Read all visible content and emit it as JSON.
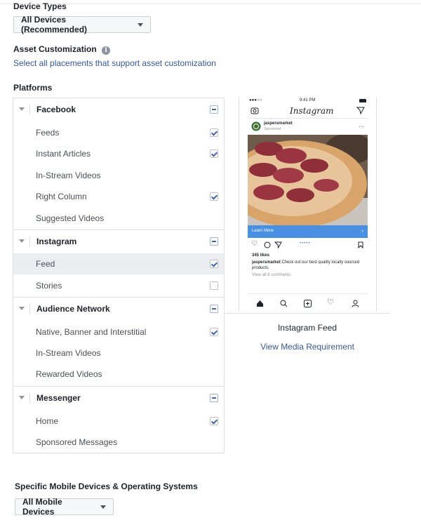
{
  "device_types": {
    "label": "Device Types",
    "dropdown": "All Devices (Recommended)"
  },
  "asset_customization": {
    "label": "Asset Customization",
    "info_icon": "info-icon",
    "link": "Select all placements that support asset customization"
  },
  "platforms": {
    "label": "Platforms",
    "groups": [
      {
        "title": "Facebook",
        "items": [
          {
            "label": "Feeds",
            "checked": true
          },
          {
            "label": "Instant Articles",
            "checked": true
          },
          {
            "label": "In-Stream Videos",
            "checked": false
          },
          {
            "label": "Right Column",
            "checked": true
          },
          {
            "label": "Suggested Videos",
            "checked": false
          }
        ]
      },
      {
        "title": "Instagram",
        "items": [
          {
            "label": "Feed",
            "checked": true
          },
          {
            "label": "Stories",
            "checked": false
          }
        ]
      },
      {
        "title": "Audience Network",
        "items": [
          {
            "label": "Native, Banner and Interstitial",
            "checked": true
          },
          {
            "label": "In-Stream Videos",
            "checked": false
          },
          {
            "label": "Rewarded Videos",
            "checked": false
          }
        ]
      },
      {
        "title": "Messenger",
        "items": [
          {
            "label": "Home",
            "checked": true
          },
          {
            "label": "Sponsored Messages",
            "checked": false
          }
        ]
      }
    ]
  },
  "preview": {
    "status_time": "9:41 PM",
    "app_logo": "Instagram",
    "account": "jaspersmarket",
    "sponsored": "Sponsored",
    "learn_more": "Learn More",
    "likes": "345 likes",
    "caption_user": "jaspersmarket",
    "caption_text": "Check out our best quality locally sourced products.",
    "view_comments": "View all 8 comments",
    "title": "Instagram Feed",
    "link": "View Media Requirement"
  },
  "mobile": {
    "label": "Specific Mobile Devices & Operating Systems",
    "dropdown": "All Mobile Devices"
  },
  "colors": {
    "link": "#365899",
    "checkbox_accent": "#4267b2",
    "selected_row": "#ebedf0",
    "learn_more_bar": "#4a90e2"
  }
}
